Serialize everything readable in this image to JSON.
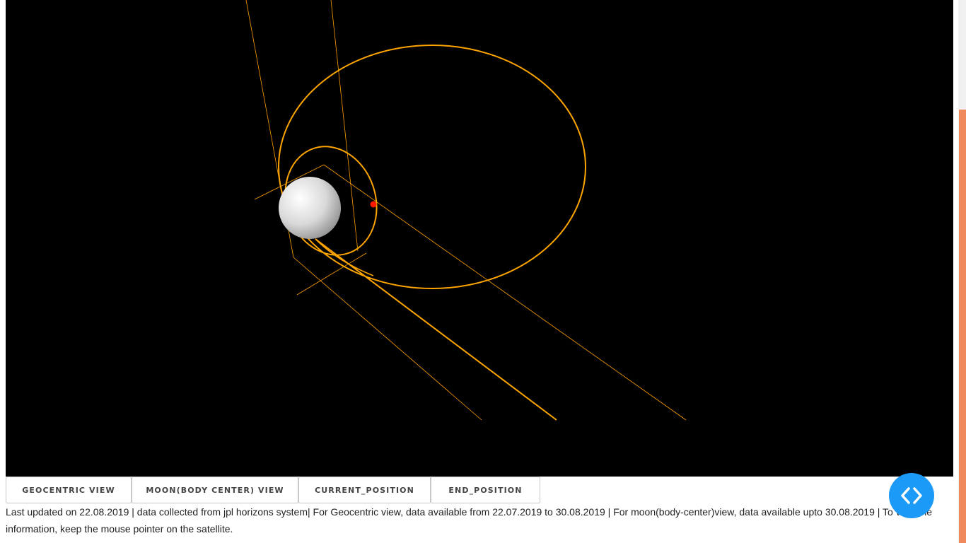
{
  "viewer": {
    "background_color": "#000000",
    "orbit_color": "#ffa500",
    "satellite_color": "#ff0000",
    "moon_color": "#e8e8e8"
  },
  "buttons": {
    "geocentric": "GEOCENTRIC VIEW",
    "moon_body_center": "MOON(BODY CENTER) VIEW",
    "current_position": "CURRENT_POSITION",
    "end_position": "END_POSITION"
  },
  "info_text": "Last updated on 22.08.2019 | data collected from jpl horizons system| For Geocentric view, data available from 22.07.2019 to 30.08.2019 | For moon(body-center)view, data available upto 30.08.2019 | To view the information, keep the mouse pointer on the satellite.",
  "floating_button": {
    "icon": "code-brackets-icon",
    "color": "#1b9af7"
  },
  "scrollbar": {
    "thumb_color": "#f08a5d"
  }
}
